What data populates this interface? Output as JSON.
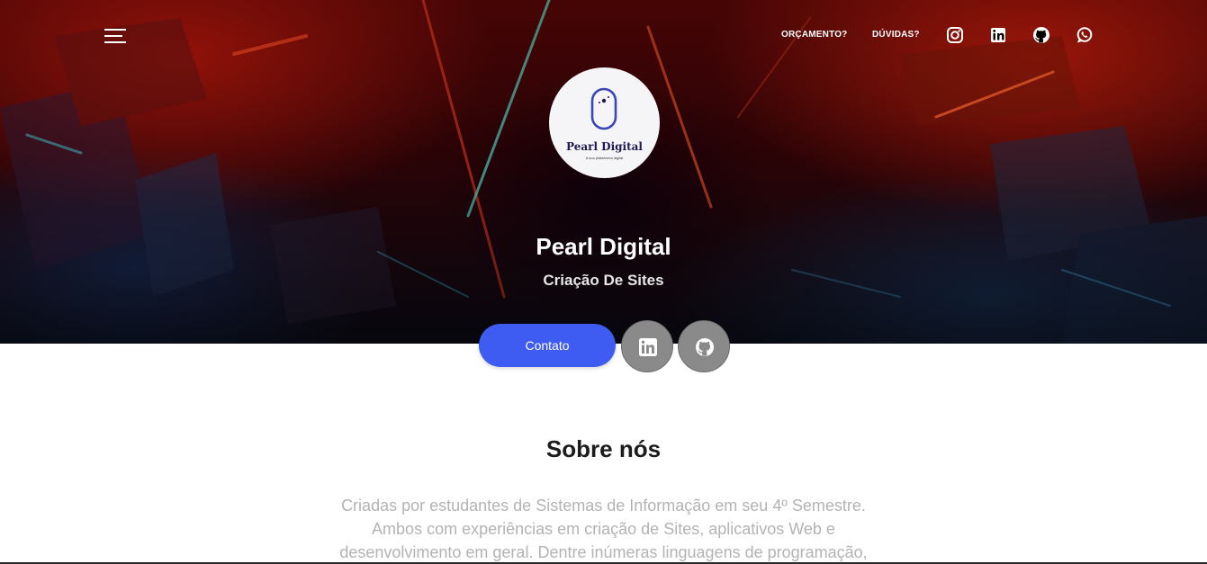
{
  "header": {
    "menu_icon": "hamburger-menu-icon",
    "nav_links": [
      "ORÇAMENTO?",
      "DÚVIDAS?"
    ],
    "social_icons": [
      "instagram-icon",
      "linkedin-icon",
      "github-icon",
      "whatsapp-icon"
    ]
  },
  "logo": {
    "name": "Pearl Digital",
    "tagline": "A sua plataforma digital",
    "accent": "#3b46b8"
  },
  "hero": {
    "title": "Pearl Digital",
    "subtitle": "Criação De Sites"
  },
  "actions": {
    "contact_label": "Contato",
    "contact_color": "#3e5cf2",
    "round_buttons": [
      "linkedin-icon",
      "github-icon"
    ],
    "round_button_color": "#8a8a8a"
  },
  "about": {
    "title": "Sobre nós",
    "lines": [
      "Criadas por estudantes de Sistemas de Informação em seu 4º Semestre.",
      "Ambos com experiências em criação de Sites, aplicativos Web e",
      "desenvolvimento em geral. Dentre inúmeras linguagens de programação,"
    ]
  }
}
